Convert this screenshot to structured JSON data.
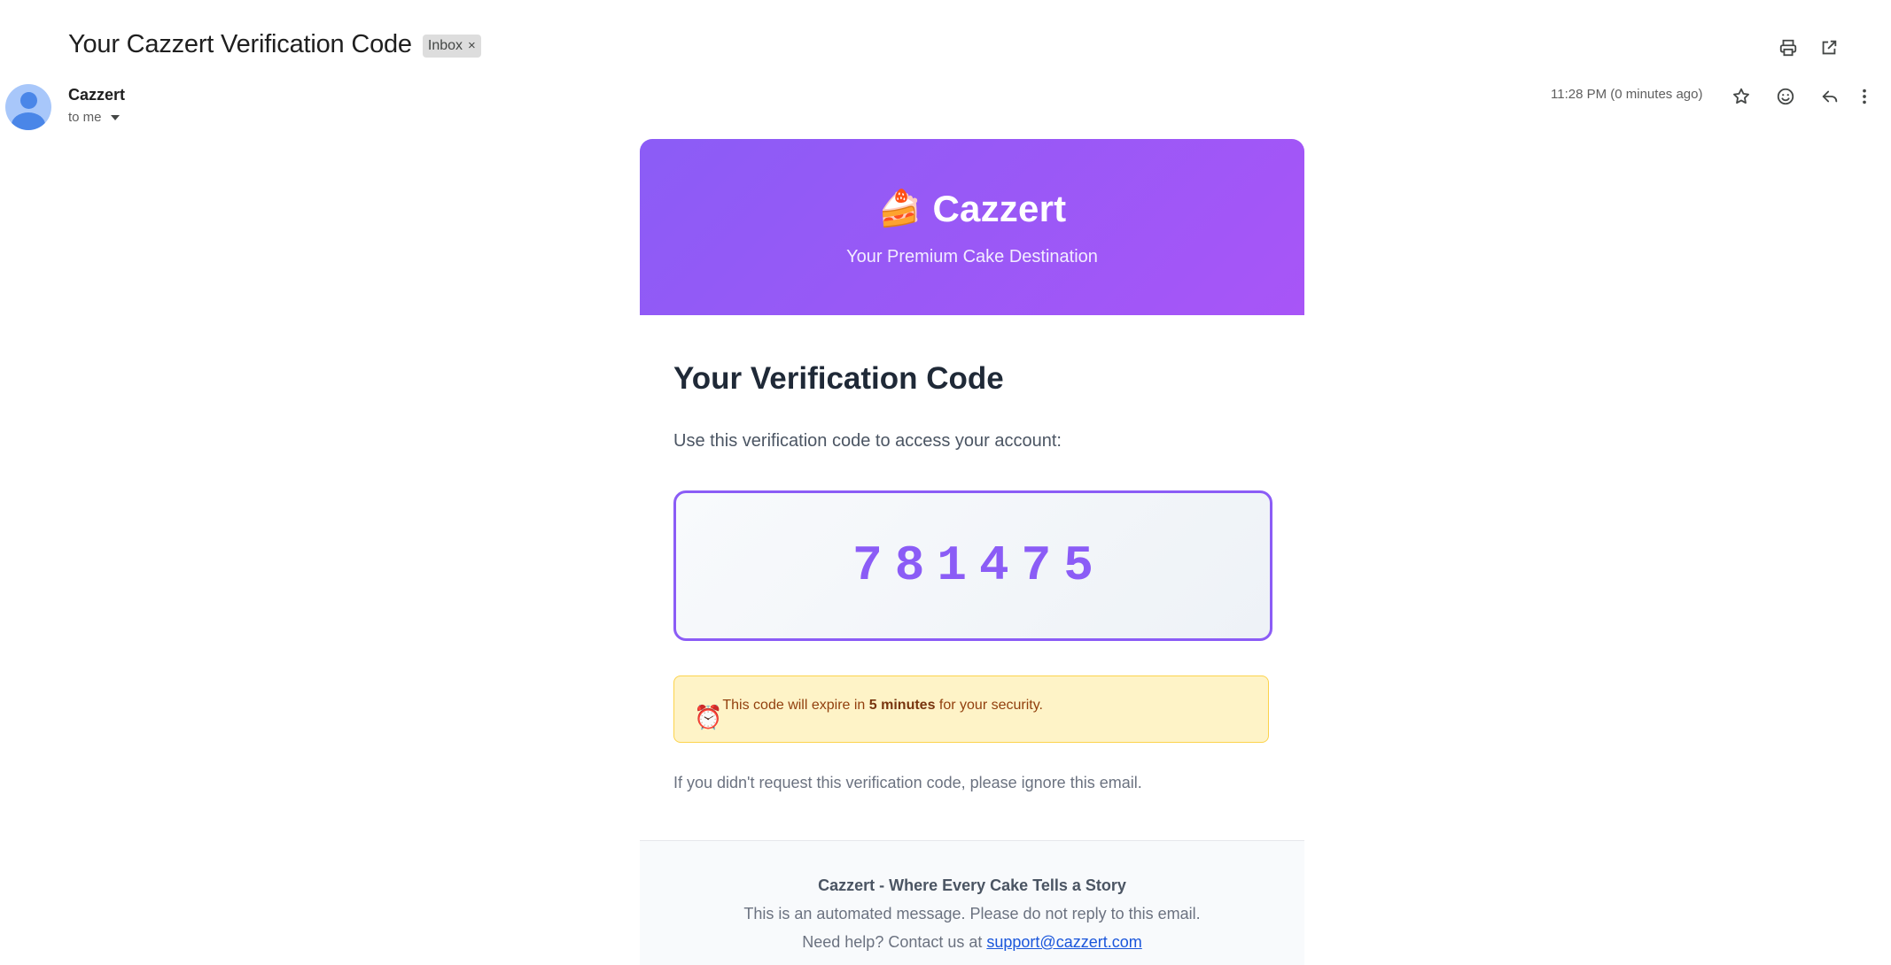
{
  "email": {
    "subject": "Your Cazzert Verification Code",
    "label": "Inbox",
    "label_remove_glyph": "×",
    "sender_name": "Cazzert",
    "recipient": "to me",
    "timestamp": "11:28 PM (0 minutes ago)"
  },
  "toolbar_icons": {
    "top": [
      "print-icon",
      "open-in-new-window-icon"
    ],
    "row": [
      "star-icon",
      "emoji-react-icon",
      "reply-icon",
      "more-options-icon"
    ]
  },
  "body": {
    "hero": {
      "logo_glyph": "🍰",
      "brand": "Cazzert",
      "tagline": "Your Premium Cake Destination",
      "gradient_start": "#8b5cf6",
      "gradient_end": "#a855f7"
    },
    "heading": "Your Verification Code",
    "instruction": "Use this verification code to access your account:",
    "code": "781475",
    "expiry": {
      "icon_glyph": "⏰",
      "prefix": "This code will expire in ",
      "duration": "5 minutes",
      "suffix": " for your security."
    },
    "ignore_note": "If you didn't request this verification code, please ignore this email.",
    "footer": {
      "brand_line": "Cazzert - Where Every Cake Tells a Story",
      "automated_line": "This is an automated message. Please do not reply to this email.",
      "help_prefix": "Need help? Contact us at ",
      "support_email": "support@cazzert.com"
    }
  },
  "colors": {
    "accent": "#8b5cf6",
    "link": "#1a56db",
    "warning_bg": "#fef3c7",
    "warning_text": "#92400e"
  }
}
